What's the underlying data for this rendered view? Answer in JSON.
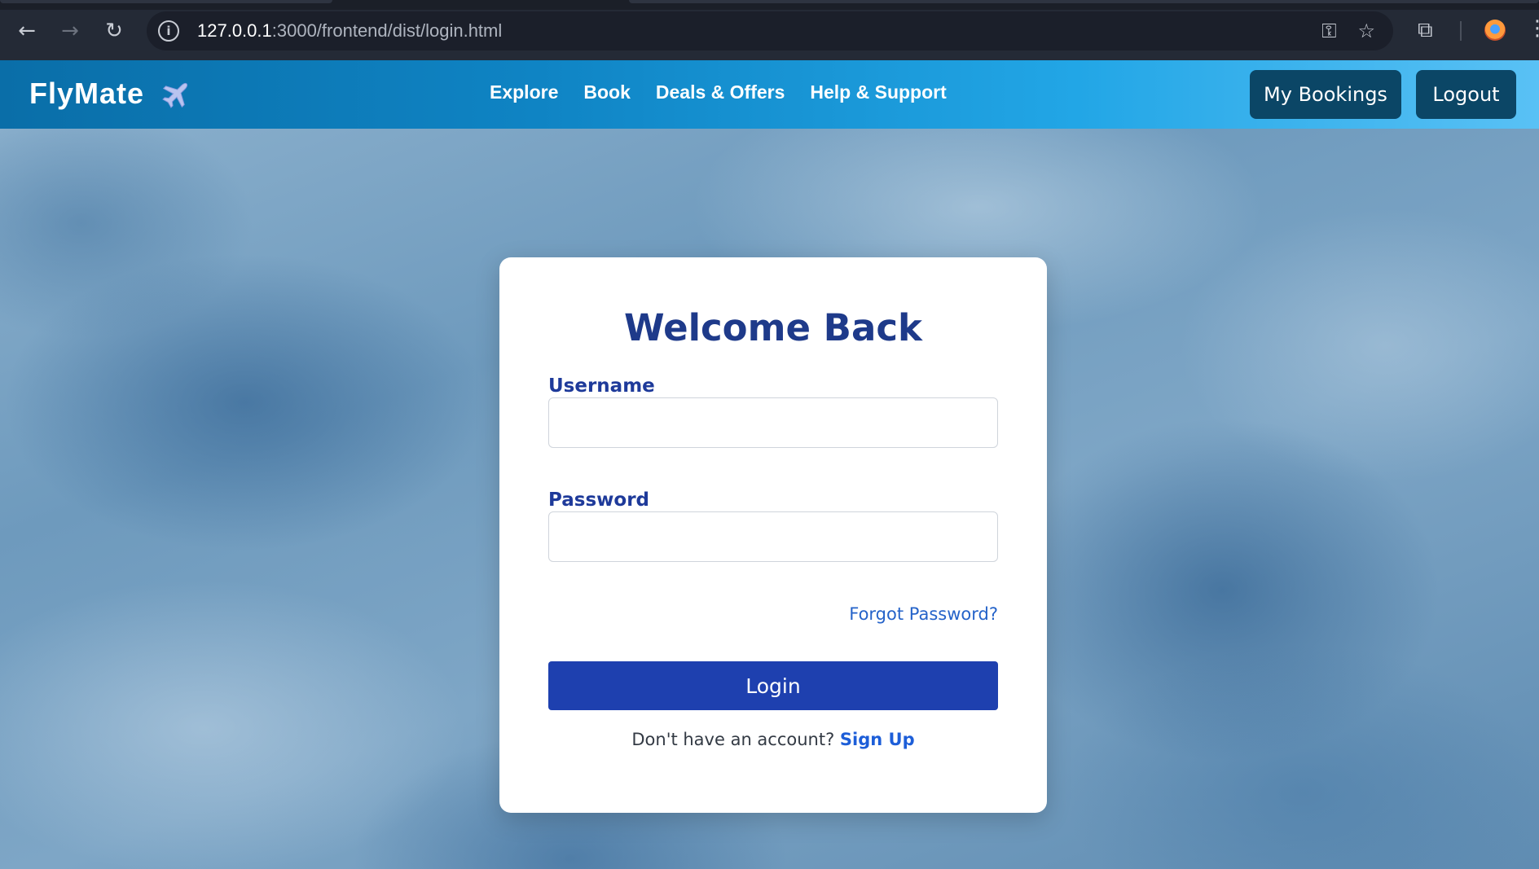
{
  "browser": {
    "url_host": "127.0.0.1",
    "url_rest": ":3000/frontend/dist/login.html",
    "icons": {
      "back": "arrow-left-icon",
      "forward": "arrow-right-icon",
      "reload": "reload-icon",
      "site_info": "info-icon",
      "password": "key-icon",
      "bookmark": "star-icon",
      "extensions": "puzzle-icon",
      "profile": "profile-icon",
      "menu": "kebab-menu-icon"
    }
  },
  "header": {
    "brand": "FlyMate",
    "brand_icon": "airplane-icon",
    "nav": [
      "Explore",
      "Book",
      "Deals & Offers",
      "Help & Support"
    ],
    "my_bookings_label": "My Bookings",
    "logout_label": "Logout",
    "colors": {
      "gradient_start": "#0a6ea8",
      "gradient_end": "#59c1f5",
      "button_bg": "#0b4666"
    }
  },
  "login": {
    "title": "Welcome Back",
    "username_label": "Username",
    "username_value": "",
    "password_label": "Password",
    "password_value": "",
    "forgot_label": "Forgot Password?",
    "login_label": "Login",
    "signup_prompt": "Don't have an account?",
    "signup_link": "Sign Up",
    "colors": {
      "title": "#1e3a8a",
      "login_button": "#1e40af",
      "link": "#2563c9"
    }
  }
}
